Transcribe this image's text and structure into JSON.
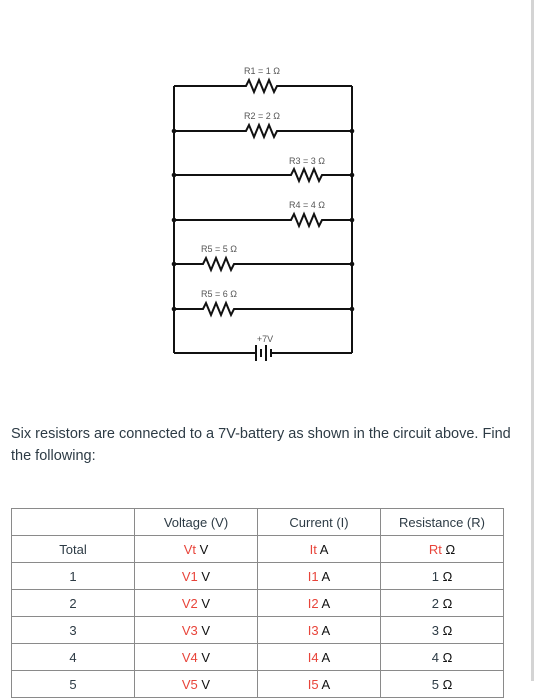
{
  "circuit": {
    "resistors": [
      {
        "label": "R1 = 1 Ω"
      },
      {
        "label": "R2 = 2 Ω"
      },
      {
        "label": "R3 = 3 Ω"
      },
      {
        "label": "R4 = 4 Ω"
      },
      {
        "label": "R5 = 5 Ω"
      },
      {
        "label": "R5 = 6 Ω"
      }
    ],
    "battery": {
      "label": "+7V"
    }
  },
  "question": "Six resistors are connected to a 7V-battery as shown in the circuit above. Find the following:",
  "table": {
    "headers": [
      "",
      "Voltage (V)",
      "Current (I)",
      "Resistance (R)"
    ],
    "rows": [
      {
        "label": "Total",
        "voltage_var": "Vt",
        "voltage_unit": "V",
        "current_var": "It",
        "current_unit": "A",
        "resistance_var": "Rt",
        "resistance_value": "",
        "resistance_unit": "Ω"
      },
      {
        "label": "1",
        "voltage_var": "V1",
        "voltage_unit": "V",
        "current_var": "I1",
        "current_unit": "A",
        "resistance_var": "",
        "resistance_value": "1",
        "resistance_unit": "Ω"
      },
      {
        "label": "2",
        "voltage_var": "V2",
        "voltage_unit": "V",
        "current_var": "I2",
        "current_unit": "A",
        "resistance_var": "",
        "resistance_value": "2",
        "resistance_unit": "Ω"
      },
      {
        "label": "3",
        "voltage_var": "V3",
        "voltage_unit": "V",
        "current_var": "I3",
        "current_unit": "A",
        "resistance_var": "",
        "resistance_value": "3",
        "resistance_unit": "Ω"
      },
      {
        "label": "4",
        "voltage_var": "V4",
        "voltage_unit": "V",
        "current_var": "I4",
        "current_unit": "A",
        "resistance_var": "",
        "resistance_value": "4",
        "resistance_unit": "Ω"
      },
      {
        "label": "5",
        "voltage_var": "V5",
        "voltage_unit": "V",
        "current_var": "I5",
        "current_unit": "A",
        "resistance_var": "",
        "resistance_value": "5",
        "resistance_unit": "Ω"
      }
    ]
  },
  "colors": {
    "variable": "#e8443a",
    "wire": "#111111",
    "label": "#555555"
  }
}
